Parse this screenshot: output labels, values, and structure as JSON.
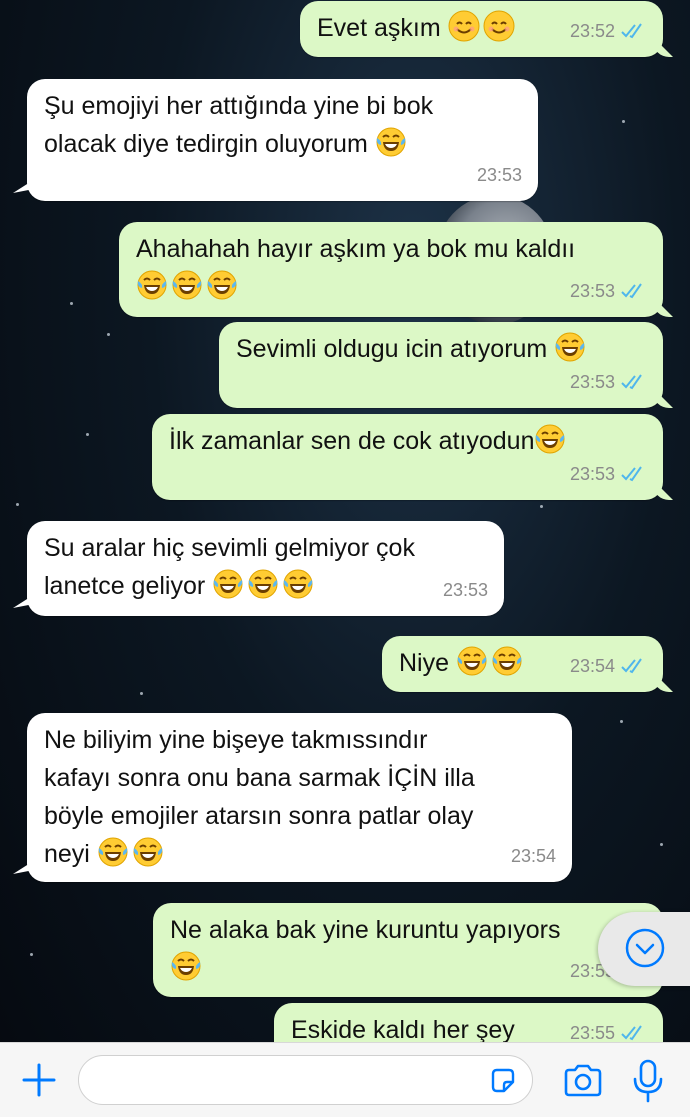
{
  "messages": [
    {
      "dir": "out",
      "text": "Evet aşkım ",
      "emoji": [
        "smile",
        "smile"
      ],
      "time": "23:52",
      "read": true
    },
    {
      "dir": "in",
      "text": "Şu emojiyi her attığında yine bi bok\nolacak diye tedirgin oluyorum ",
      "emoji": [
        "joy"
      ],
      "time": "23:53"
    },
    {
      "dir": "out",
      "text": "Ahahahah hayır aşkım ya bok mu kaldıı\n",
      "emoji": [
        "joy",
        "joy",
        "joy"
      ],
      "time": "23:53",
      "read": true
    },
    {
      "dir": "out",
      "text": "Sevimli oldugu icin atıyorum ",
      "emoji": [
        "joy"
      ],
      "time": "23:53",
      "read": true
    },
    {
      "dir": "out",
      "text": "İlk zamanlar sen de cok atıyodun",
      "emoji": [
        "joy"
      ],
      "time": "23:53",
      "read": true
    },
    {
      "dir": "in",
      "text": "Su aralar hiç sevimli gelmiyor çok\nlanetce geliyor ",
      "emoji": [
        "joy",
        "joy",
        "joy"
      ],
      "time": "23:53"
    },
    {
      "dir": "out",
      "text": "Niye ",
      "emoji": [
        "joy",
        "joy"
      ],
      "time": "23:54",
      "read": true
    },
    {
      "dir": "in",
      "text": "Ne biliyim yine bişeye takmıssındır\nkafayı sonra onu bana sarmak İÇİN illa\nböyle emojiler atarsın sonra patlar olay\nneyi ",
      "emoji": [
        "joy",
        "joy"
      ],
      "time": "23:54"
    },
    {
      "dir": "out",
      "text": "Ne alaka bak yine kuruntu yapıyors\n",
      "emoji": [
        "joy"
      ],
      "time": "23:55",
      "read": true
    },
    {
      "dir": "out",
      "text": "Eskide kaldı her şey",
      "emoji": [],
      "time": "23:55",
      "read": true
    }
  ],
  "input": {
    "placeholder": ""
  },
  "icons": {
    "attach": "plus-icon",
    "sticker": "sticker-icon",
    "camera": "camera-icon",
    "mic": "microphone-icon",
    "scroll": "chevron-down-icon",
    "read_receipt": "double-check-icon"
  },
  "colors": {
    "outgoing_bubble": "#dcf8c6",
    "incoming_bubble": "#ffffff",
    "accent": "#007aff",
    "read_ticks": "#4fb6ec"
  }
}
